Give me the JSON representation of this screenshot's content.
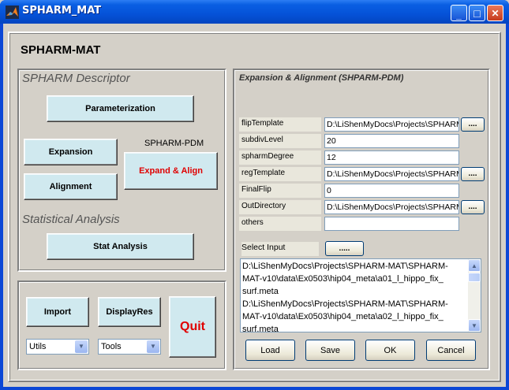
{
  "window": {
    "title": "SPHARM_MAT",
    "minimize": "_",
    "maximize": "□",
    "close": "✕"
  },
  "app": {
    "title": "SPHARM-MAT"
  },
  "descriptor": {
    "title": "SPHARM Descriptor",
    "parameterization": "Parameterization",
    "expansion": "Expansion",
    "alignment": "Alignment",
    "spharm_pdm_label": "SPHARM-PDM",
    "expand_align": "Expand & Align",
    "stat_title": "Statistical Analysis",
    "stat_analysis": "Stat Analysis"
  },
  "bottom": {
    "import": "Import",
    "display_res": "DisplayRes",
    "quit": "Quit",
    "utils_select": "Utils",
    "tools_select": "Tools"
  },
  "right": {
    "title": "Expansion & Alignment (SHPARM-PDM)",
    "params": [
      {
        "label": "flipTemplate",
        "value": "D:\\LiShenMyDocs\\Projects\\SPHARM-",
        "has_button": true
      },
      {
        "label": "subdivLevel",
        "value": "20",
        "has_button": false
      },
      {
        "label": "spharmDegree",
        "value": "12",
        "has_button": false
      },
      {
        "label": "regTemplate",
        "value": "D:\\LiShenMyDocs\\Projects\\SPHARM-",
        "has_button": true
      },
      {
        "label": "FinalFlip",
        "value": "0",
        "has_button": false
      },
      {
        "label": "OutDirectory",
        "value": "D:\\LiShenMyDocs\\Projects\\SPHARM-",
        "has_button": true
      },
      {
        "label": "others",
        "value": "",
        "has_button": false
      }
    ],
    "dots": "....",
    "select_input_label": "Select Input",
    "select_input_button": ".....",
    "input_list": [
      "D:\\LiShenMyDocs\\Projects\\SPHARM-MAT\\SPHARM-",
      "MAT-v10\\data\\Ex0503\\hip04_meta\\a01_l_hippo_fix_",
      "surf.meta",
      "D:\\LiShenMyDocs\\Projects\\SPHARM-MAT\\SPHARM-",
      "MAT-v10\\data\\Ex0503\\hip04_meta\\a02_l_hippo_fix_",
      "surf.meta"
    ],
    "load": "Load",
    "save": "Save",
    "ok": "OK",
    "cancel": "Cancel"
  },
  "colors": {
    "button_face": "#d0e9ef",
    "expand_align_text": "#e00000",
    "quit_text": "#e00000",
    "titlebar": "#0552d8"
  }
}
